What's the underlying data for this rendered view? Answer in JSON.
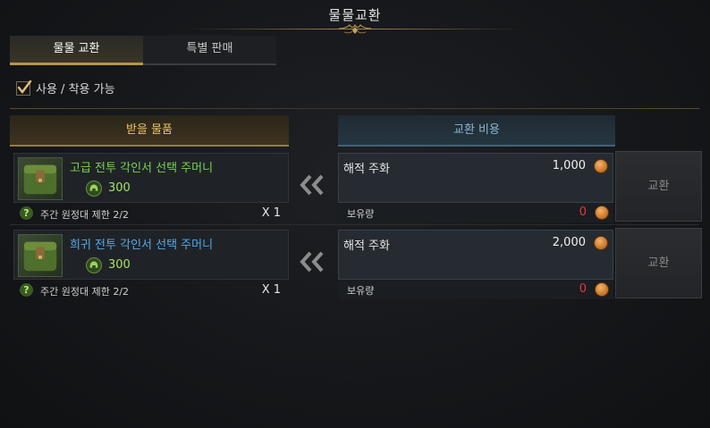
{
  "window": {
    "title": "물물교환"
  },
  "tabs": [
    {
      "label": "물물 교환",
      "active": true
    },
    {
      "label": "특별 판매",
      "active": false
    }
  ],
  "filter": {
    "label": "사용 / 착용 가능",
    "checked": true
  },
  "headers": {
    "receive": "받을 물품",
    "cost": "교환 비용"
  },
  "rows": [
    {
      "item_name": "고급 전투 각인서 선택 주머니",
      "item_color": "#79d24a",
      "item_count": "300",
      "limit": "주간 원정대 제한 2/2",
      "qty": "X 1",
      "cost_label": "해적 주화",
      "cost_value": "1,000",
      "owned_label": "보유량",
      "owned_value": "0",
      "button": "교환"
    },
    {
      "item_name": "희귀 전투 각인서 선택 주머니",
      "item_color": "#55a9e6",
      "item_count": "300",
      "limit": "주간 원정대 제한 2/2",
      "qty": "X 1",
      "cost_label": "해적 주화",
      "cost_value": "2,000",
      "owned_label": "보유량",
      "owned_value": "0",
      "button": "교환"
    }
  ],
  "icons": {
    "bag": "pouch-icon",
    "helm": "helmet-icon",
    "coin": "pirate-coin-icon",
    "help": "question-icon",
    "arrows": "double-chevron-left-icon"
  }
}
